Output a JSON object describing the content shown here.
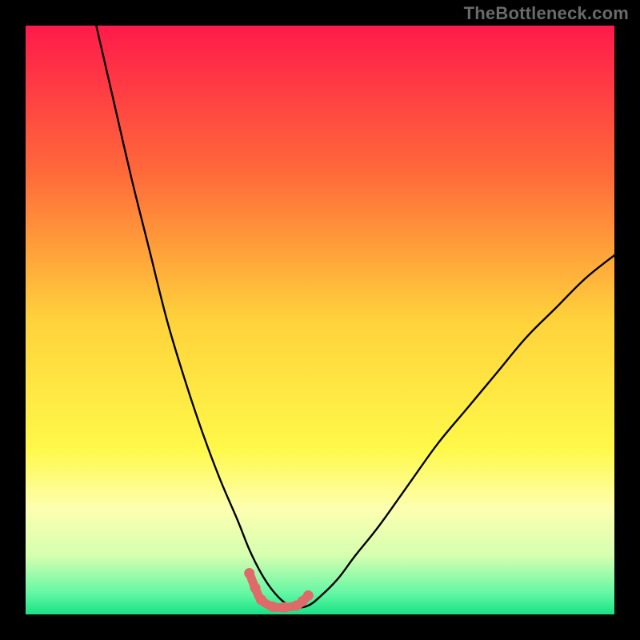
{
  "watermark": {
    "text": "TheBottleneck.com"
  },
  "chart_data": {
    "type": "line",
    "title": "",
    "xlabel": "",
    "ylabel": "",
    "xlim": [
      0,
      100
    ],
    "ylim": [
      0,
      100
    ],
    "note": "Axes are unlabeled; values are estimated normalized percentages. The curve depicts a bottleneck-vs-parameter shape with a flat minimum near 0 around x≈40–47.",
    "background_gradient_stops": [
      {
        "pos": 0.0,
        "color": "#ff1a4b"
      },
      {
        "pos": 0.25,
        "color": "#ff6a3a"
      },
      {
        "pos": 0.5,
        "color": "#ffd23b"
      },
      {
        "pos": 0.72,
        "color": "#fff94a"
      },
      {
        "pos": 0.82,
        "color": "#fdffb0"
      },
      {
        "pos": 0.9,
        "color": "#d6ffb0"
      },
      {
        "pos": 0.965,
        "color": "#61f7a4"
      },
      {
        "pos": 1.0,
        "color": "#18e184"
      }
    ],
    "series": [
      {
        "name": "bottleneck-curve",
        "x": [
          12,
          15,
          18,
          21,
          24,
          27,
          30,
          33,
          36,
          38,
          40,
          42,
          44,
          46,
          48,
          50,
          53,
          56,
          60,
          65,
          70,
          75,
          80,
          85,
          90,
          95,
          100
        ],
        "y": [
          100,
          87,
          74,
          62,
          50,
          40,
          31,
          23,
          16,
          11,
          7,
          4,
          2,
          1.2,
          1.5,
          3,
          6,
          10,
          15,
          22,
          29,
          35,
          41,
          47,
          52,
          57,
          61
        ]
      }
    ],
    "highlight_segment": {
      "name": "near-minimum-markers",
      "color": "#e06a6a",
      "x": [
        38,
        39,
        40,
        42,
        44,
        46,
        47,
        48
      ],
      "y": [
        7,
        4.5,
        2.5,
        1.3,
        1.2,
        1.5,
        2.2,
        3.2
      ]
    }
  }
}
